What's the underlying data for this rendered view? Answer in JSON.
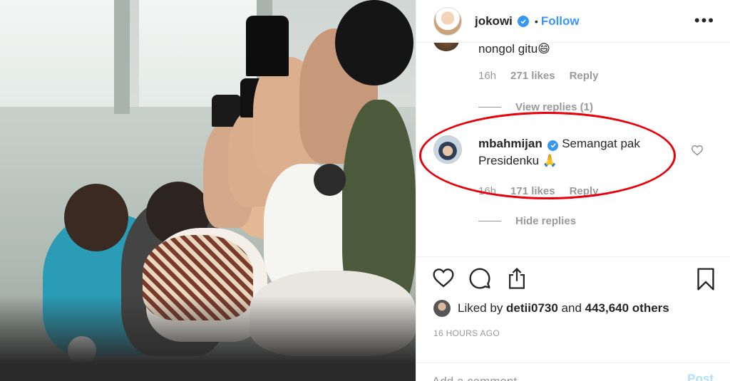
{
  "post": {
    "username": "jokowi",
    "follow_label": "Follow",
    "separator": "•",
    "more_label": "•••"
  },
  "comments": {
    "first": {
      "text": "nongol gitu😄",
      "time": "16h",
      "likes": "271 likes",
      "reply": "Reply",
      "view_replies": "View replies (1)"
    },
    "second": {
      "username": "mbahmijan",
      "text": "Semangat pak Presidenku 🙏",
      "time": "16h",
      "likes": "171 likes",
      "reply": "Reply",
      "hide_replies": "Hide replies"
    }
  },
  "actions": {
    "liked_prefix": "Liked by ",
    "liked_user": "detii0730",
    "liked_and": " and ",
    "liked_count": "443,640 others",
    "timestamp": "16 HOURS AGO",
    "add_placeholder": "Add a comment...",
    "post_label": "Post"
  },
  "colors": {
    "accent": "#3897f0",
    "highlight": "#e8000b",
    "muted": "#999999"
  },
  "icons": [
    "verified-icon",
    "more-options-icon",
    "heart-icon",
    "comment-icon",
    "share-icon",
    "bookmark-icon"
  ]
}
